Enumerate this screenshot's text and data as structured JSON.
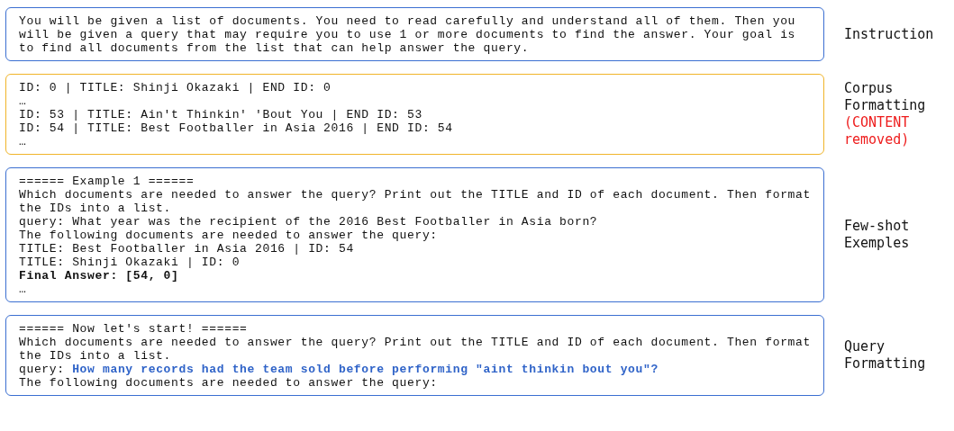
{
  "sections": [
    {
      "color": "#3b6fd1",
      "label": [
        {
          "text": "Instruction",
          "kind": "plain"
        }
      ],
      "lines": [
        {
          "text": "You will be given a list of documents. You need to read carefully and understand all of them. Then you",
          "kind": "plain"
        },
        {
          "text": "will be given a query that may require you to use 1 or more documents to find the answer. Your goal is",
          "kind": "plain"
        },
        {
          "text": "to find all documents from the list that can help answer the query.",
          "kind": "plain"
        }
      ]
    },
    {
      "color": "#f0b429",
      "label": [
        {
          "text": "Corpus",
          "kind": "plain"
        },
        {
          "text": "Formatting",
          "kind": "plain"
        },
        {
          "text": "(CONTENT",
          "kind": "note"
        },
        {
          "text": "removed)",
          "kind": "note"
        }
      ],
      "lines": [
        {
          "text": "ID: 0 | TITLE: Shinji Okazaki | END ID: 0",
          "kind": "plain"
        },
        {
          "text": "…",
          "kind": "plain"
        },
        {
          "text": "ID: 53 | TITLE: Ain't Thinkin' 'Bout You | END ID: 53",
          "kind": "plain"
        },
        {
          "text": "ID: 54 | TITLE: Best Footballer in Asia 2016 | END ID: 54",
          "kind": "plain"
        },
        {
          "text": "…",
          "kind": "plain"
        }
      ]
    },
    {
      "color": "#3b6fd1",
      "label": [
        {
          "text": "Few-shot",
          "kind": "plain"
        },
        {
          "text": "Exemples",
          "kind": "plain"
        }
      ],
      "lines": [
        {
          "text": "====== Example 1 ======",
          "kind": "plain"
        },
        {
          "text": "Which documents are needed to answer the query? Print out the TITLE and ID of each document. Then format",
          "kind": "plain"
        },
        {
          "text": "the IDs into a list.",
          "kind": "plain"
        },
        {
          "text": "query: What year was the recipient of the 2016 Best Footballer in Asia born?",
          "kind": "plain"
        },
        {
          "text": "The following documents are needed to answer the query:",
          "kind": "plain"
        },
        {
          "text": "TITLE: Best Footballer in Asia 2016 | ID: 54",
          "kind": "plain"
        },
        {
          "text": "TITLE: Shinji Okazaki | ID: 0",
          "kind": "plain"
        },
        {
          "text": "Final Answer: [54, 0]",
          "kind": "bold"
        },
        {
          "text": "…",
          "kind": "plain"
        }
      ]
    },
    {
      "color": "#3b6fd1",
      "label": [
        {
          "text": "Query",
          "kind": "plain"
        },
        {
          "text": "Formatting",
          "kind": "plain"
        }
      ],
      "lines": [
        {
          "text": "====== Now let's start! ======",
          "kind": "plain"
        },
        {
          "text": "Which documents are needed to answer the query? Print out the TITLE and ID of each document. Then format",
          "kind": "plain"
        },
        {
          "text": "the IDs into a list.",
          "kind": "plain"
        },
        {
          "text": "query: **How many records had the team sold before performing \"aint thinkin bout you\"?**",
          "kind": "query"
        },
        {
          "text": "The following documents are needed to answer the query:",
          "kind": "plain"
        }
      ]
    }
  ]
}
